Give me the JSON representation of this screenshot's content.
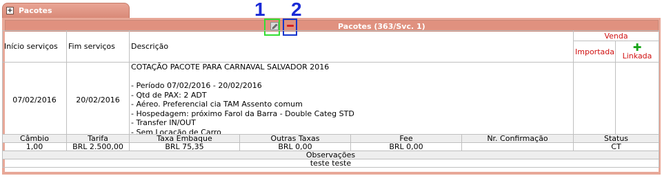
{
  "tab": {
    "title": "Pacotes",
    "expand_symbol": "+"
  },
  "section": {
    "title": "Pacotes (363/Svc. 1)"
  },
  "annotations": {
    "label1": "1",
    "label2": "2"
  },
  "columns": {
    "inicio": "Início serviços",
    "fim": "Fim serviços",
    "descricao": "Descrição",
    "venda": "Venda",
    "importada": "Importada",
    "linkada": "Linkada"
  },
  "row": {
    "inicio": "07/02/2016",
    "fim": "20/02/2016",
    "descricao": [
      "COTAÇÃO PACOTE PARA CARNAVAL SALVADOR 2016",
      "",
      "- Período 07/02/2016 - 20/02/2016",
      "- Qtd de PAX: 2 ADT",
      "- Aéreo. Preferencial cia TAM Assento comum",
      "- Hospedagem: próximo Farol da Barra - Double Categ STD",
      "- Transfer IN/OUT",
      "- Sem Locação de Carro"
    ]
  },
  "details_headers": [
    "Câmbio",
    "Tarifa",
    "Taxa Embaque",
    "Outras Taxas",
    "Fee",
    "Nr. Confirmação",
    "Status"
  ],
  "details_values": [
    "1,00",
    "BRL 2.500,00",
    "BRL 75,35",
    "BRL 0,00",
    "BRL 0,00",
    "",
    "CT"
  ],
  "observacoes": {
    "label": "Observações",
    "value": "teste teste"
  },
  "colors": {
    "frame": "#e8a898",
    "header": "#e0917f",
    "accent_red": "#d01010",
    "green": "#1aa51a",
    "annotation_blue": "#1a2ad6",
    "annotation_green": "#33dd33"
  },
  "icons": {
    "edit": "pencil-icon",
    "collapse": "minus-icon",
    "add_link": "plus-icon"
  }
}
